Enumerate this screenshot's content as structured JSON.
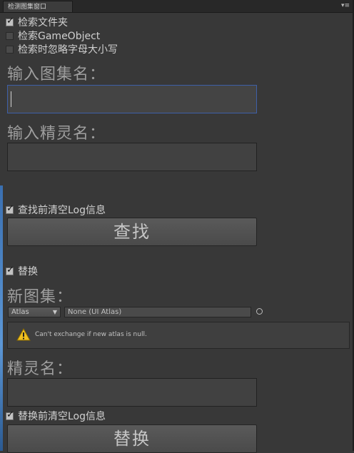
{
  "window": {
    "tab_title": "检测图集窗口",
    "menu_icon": "▾≡"
  },
  "options": {
    "search_folder": {
      "label": "检索文件夹",
      "checked": true
    },
    "search_gameobject": {
      "label": "检索GameObject",
      "checked": false
    },
    "ignore_case": {
      "label": "检索时忽略字母大小写",
      "checked": false
    }
  },
  "atlas_input": {
    "label": "输入图集名：",
    "value": ""
  },
  "sprite_input": {
    "label": "输入精灵名：",
    "value": ""
  },
  "clear_before_search": {
    "label": "查找前清空Log信息",
    "checked": true
  },
  "find_button": {
    "label": "查找"
  },
  "replace_toggle": {
    "label": "替换",
    "checked": true
  },
  "new_atlas": {
    "label": "新图集：",
    "type_dropdown": "Atlas",
    "object_field": "None (UI Atlas)",
    "picker_icon": "object-picker-icon"
  },
  "warning": {
    "icon": "warning-icon",
    "text": "Can't exchange if new atlas is null."
  },
  "sprite_name": {
    "label": "精灵名：",
    "value": ""
  },
  "clear_before_replace": {
    "label": "替换前清空Log信息",
    "checked": true
  },
  "replace_button": {
    "label": "替换"
  },
  "colors": {
    "background": "#383838",
    "focus_border": "#3e5fa8",
    "warning_yellow": "#f0c020"
  }
}
